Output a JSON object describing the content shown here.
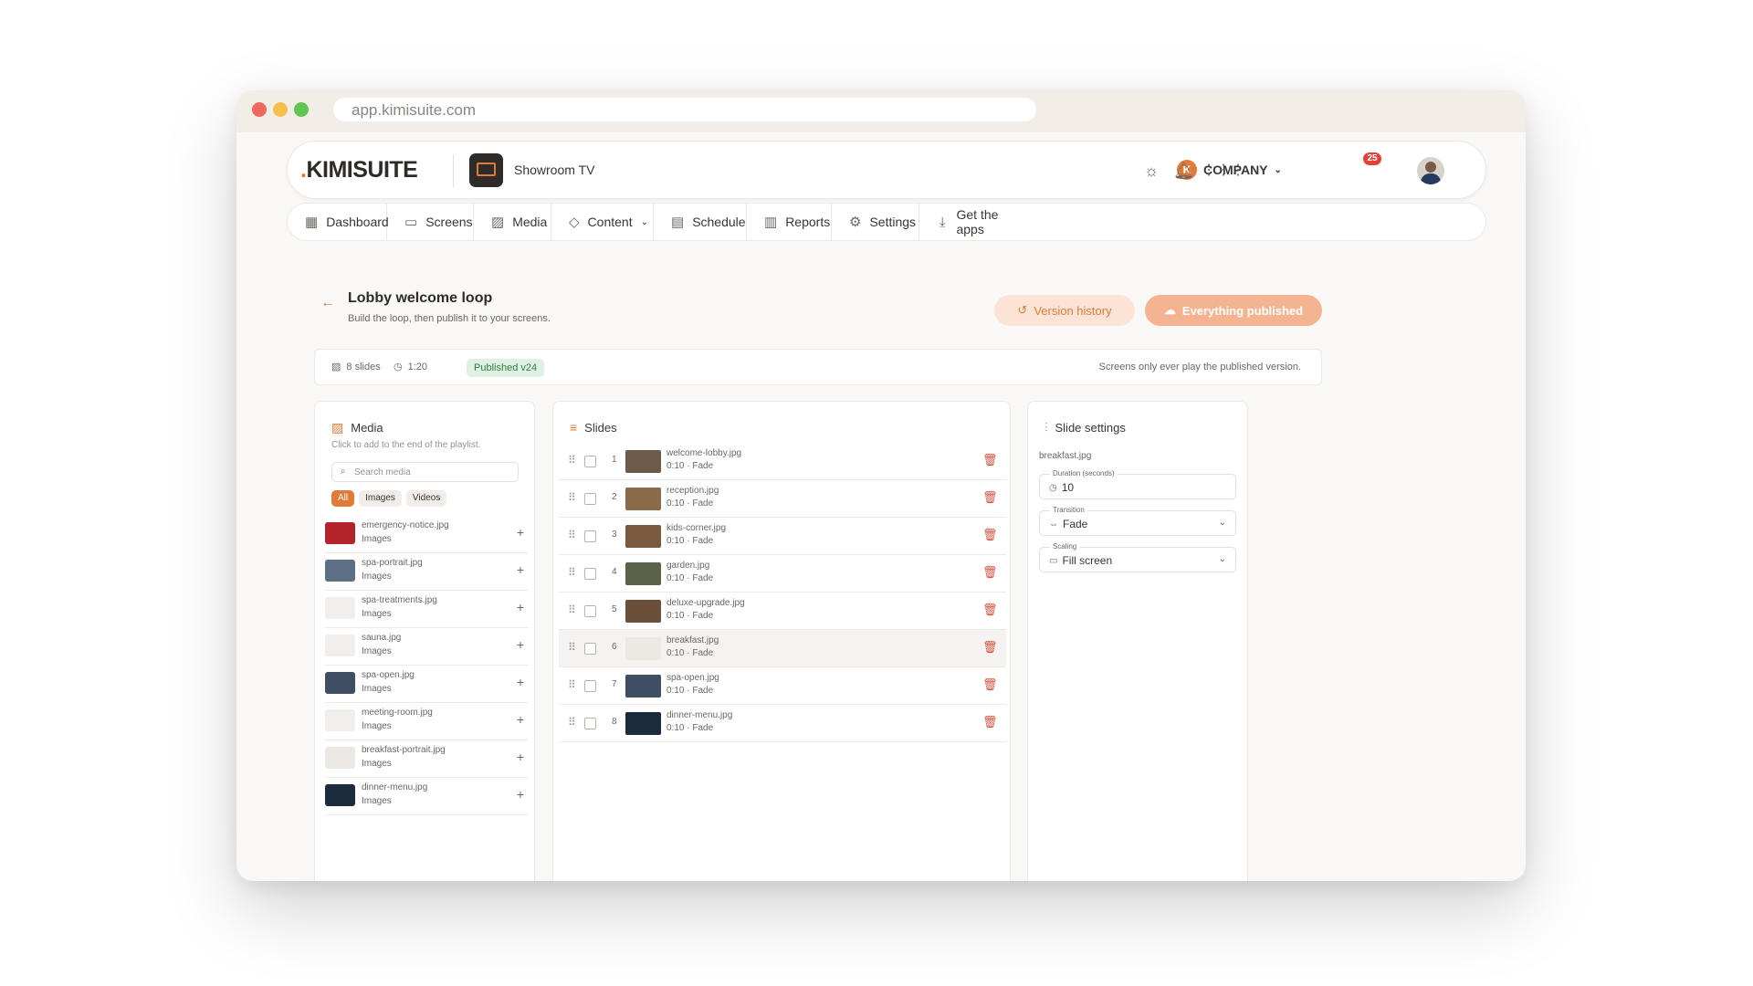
{
  "browser": {
    "url": "app.kimisuite.com"
  },
  "topbar": {
    "logo_dot": ".",
    "logo_text": "KIMISUITE",
    "screen_name": "Showroom TV",
    "company_initial": "K",
    "company_label": "COMPANY",
    "notification_count": "25"
  },
  "nav": [
    {
      "label": "Dashboard",
      "icon": "dashboard-icon"
    },
    {
      "label": "Screens",
      "icon": "tv-icon"
    },
    {
      "label": "Media",
      "icon": "image-icon"
    },
    {
      "label": "Content",
      "icon": "layers-icon"
    },
    {
      "label": "Schedule",
      "icon": "calendar-icon"
    },
    {
      "label": "Reports",
      "icon": "bar-chart-icon"
    },
    {
      "label": "Settings",
      "icon": "gear-icon"
    },
    {
      "label": "Get the apps",
      "icon": "download-icon"
    }
  ],
  "page": {
    "title": "Lobby welcome loop",
    "subtitle": "Build the loop, then publish it to your screens.",
    "version_history_label": "Version history",
    "publish_label": "Everything published"
  },
  "info": {
    "slides_count": "8 slides",
    "duration": "1:20",
    "published_badge": "Published v24",
    "note": "Screens only ever play the published version."
  },
  "media_panel": {
    "title": "Media",
    "hint": "Click to add to the end of the playlist.",
    "search_placeholder": "Search media",
    "filters": [
      "All",
      "Images",
      "Videos"
    ],
    "items": [
      {
        "name": "emergency-notice.jpg",
        "type": "Images",
        "thumb": "#b4222a"
      },
      {
        "name": "spa-portrait.jpg",
        "type": "Images",
        "thumb": "#5d6f83"
      },
      {
        "name": "spa-treatments.jpg",
        "type": "Images",
        "thumb": "#f1eeeb"
      },
      {
        "name": "sauna.jpg",
        "type": "Images",
        "thumb": "#f1eeeb"
      },
      {
        "name": "spa-open.jpg",
        "type": "Images",
        "thumb": "#3f4e63"
      },
      {
        "name": "meeting-room.jpg",
        "type": "Images",
        "thumb": "#f1eeeb"
      },
      {
        "name": "breakfast-portrait.jpg",
        "type": "Images",
        "thumb": "#ebe7e2"
      },
      {
        "name": "dinner-menu.jpg",
        "type": "Images",
        "thumb": "#1b2a3d"
      }
    ]
  },
  "slides_panel": {
    "title": "Slides",
    "items": [
      {
        "num": "1",
        "name": "welcome-lobby.jpg",
        "meta": "0:10 · Fade",
        "thumb": "#6e5a48"
      },
      {
        "num": "2",
        "name": "reception.jpg",
        "meta": "0:10 · Fade",
        "thumb": "#8b6a4a"
      },
      {
        "num": "3",
        "name": "kids-corner.jpg",
        "meta": "0:10 · Fade",
        "thumb": "#7a5a3f"
      },
      {
        "num": "4",
        "name": "garden.jpg",
        "meta": "0:10 · Fade",
        "thumb": "#5a6248"
      },
      {
        "num": "5",
        "name": "deluxe-upgrade.jpg",
        "meta": "0:10 · Fade",
        "thumb": "#6a4f3a"
      },
      {
        "num": "6",
        "name": "breakfast.jpg",
        "meta": "0:10 · Fade",
        "thumb": "#ece8e3"
      },
      {
        "num": "7",
        "name": "spa-open.jpg",
        "meta": "0:10 · Fade",
        "thumb": "#3f4e63"
      },
      {
        "num": "8",
        "name": "dinner-menu.jpg",
        "meta": "0:10 · Fade",
        "thumb": "#1b2a3d"
      }
    ],
    "selected_index": 5
  },
  "settings_panel": {
    "title": "Slide settings",
    "file": "breakfast.jpg",
    "duration_label": "Duration (seconds)",
    "duration_value": "10",
    "transition_label": "Transition",
    "transition_value": "Fade",
    "scaling_label": "Scaling",
    "scaling_value": "Fill screen"
  },
  "colors": {
    "accent": "#e07b39",
    "danger": "#d8503f",
    "success": "#2f7d44"
  }
}
